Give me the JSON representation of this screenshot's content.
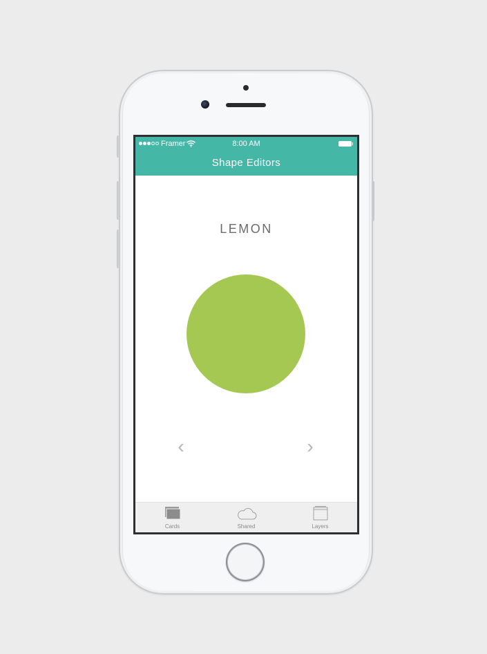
{
  "status_bar": {
    "carrier": "Framer",
    "time": "8:00 AM",
    "signal_bars_filled": 3,
    "signal_bars_total": 5,
    "battery_level": 1.0
  },
  "nav": {
    "title": "Shape Editors"
  },
  "shape": {
    "name": "LEMON",
    "color": "#a5c852"
  },
  "pager": {
    "prev_icon": "chevron-left-icon",
    "next_icon": "chevron-right-icon",
    "prev_glyph": "‹",
    "next_glyph": "›"
  },
  "tab_bar": {
    "tabs": [
      {
        "label": "Cards",
        "icon": "cards-icon"
      },
      {
        "label": "Shared",
        "icon": "cloud-icon"
      },
      {
        "label": "Layers",
        "icon": "layers-icon"
      }
    ]
  },
  "colors": {
    "header": "#45b7a7",
    "background": "#ececec",
    "tab_bar": "#efefef"
  }
}
